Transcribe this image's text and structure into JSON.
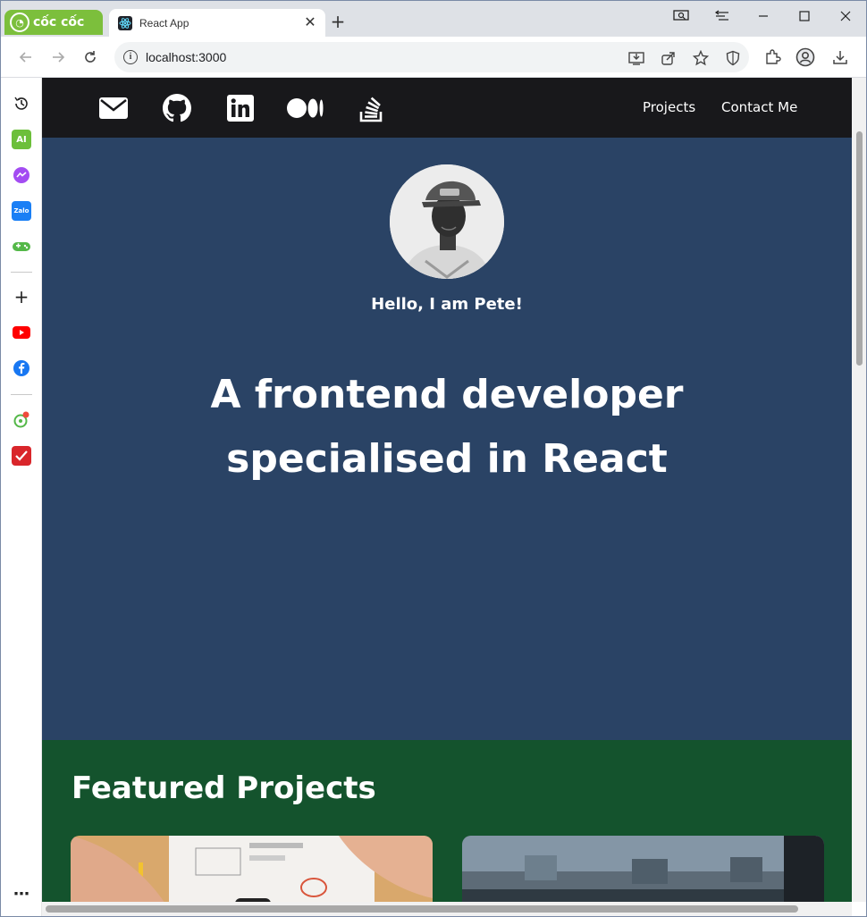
{
  "browser": {
    "brand": "cốc cốc",
    "tab_title": "React App",
    "url": "localhost:3000"
  },
  "site": {
    "social_icons": [
      "envelope-icon",
      "github-icon",
      "linkedin-icon",
      "medium-icon",
      "stackoverflow-icon"
    ],
    "nav": [
      {
        "label": "Projects"
      },
      {
        "label": "Contact Me"
      }
    ],
    "hero": {
      "greeting": "Hello, I am Pete!",
      "headline_line1": "A frontend developer",
      "headline_line2": "specialised in React"
    },
    "projects": {
      "title": "Featured Projects"
    }
  },
  "colors": {
    "header_bg": "#18181b",
    "hero_bg": "#2a4365",
    "projects_bg": "#14532d",
    "brand_green": "#7cbf3c"
  }
}
